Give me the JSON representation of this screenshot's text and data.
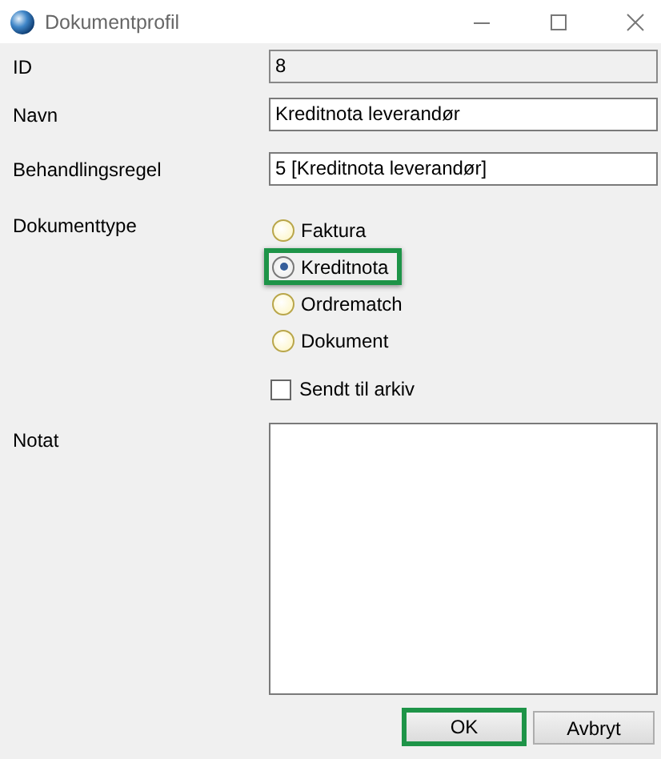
{
  "window": {
    "title": "Dokumentprofil"
  },
  "fields": [
    {
      "label": "ID",
      "value": "8",
      "disabled": true
    },
    {
      "label": "Navn",
      "value": "Kreditnota leverandør",
      "disabled": false
    },
    {
      "label": "Behandlingsregel",
      "value": "5 [Kreditnota leverandør]",
      "disabled": false
    }
  ],
  "document_type": {
    "label": "Dokumenttype",
    "options": [
      {
        "label": "Faktura",
        "selected": false,
        "highlighted": false
      },
      {
        "label": "Kreditnota",
        "selected": true,
        "highlighted": true
      },
      {
        "label": "Ordrematch",
        "selected": false,
        "highlighted": false
      },
      {
        "label": "Dokument",
        "selected": false,
        "highlighted": false
      }
    ]
  },
  "archive_checkbox": {
    "label": "Sendt til arkiv",
    "checked": false
  },
  "note": {
    "label": "Notat"
  },
  "buttons": [
    {
      "label": "OK",
      "highlighted": true
    },
    {
      "label": "Avbryt",
      "highlighted": false
    }
  ]
}
